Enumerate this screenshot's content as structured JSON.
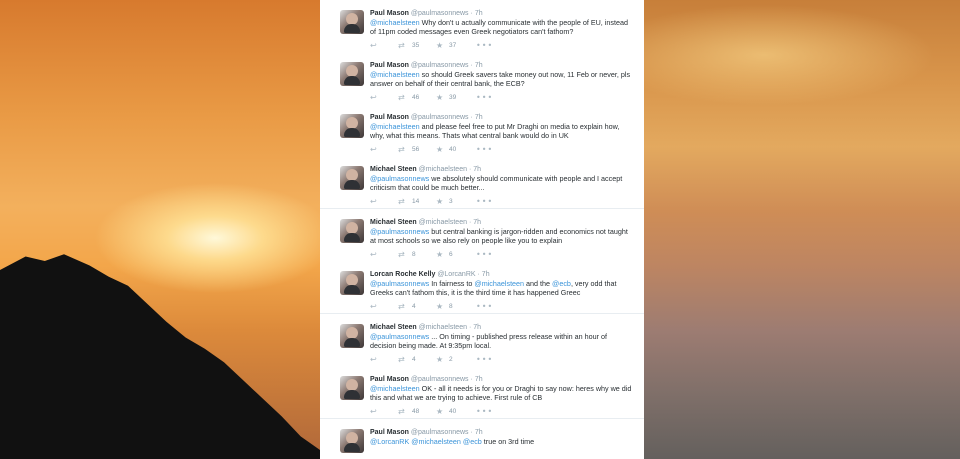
{
  "tweets": [
    {
      "name": "Paul Mason",
      "handle": "@paulmasonnews",
      "time": "7h",
      "mentions": [
        "@michaelsteen"
      ],
      "text": " Why don't u actually communicate with the people of EU, instead of 11pm coded messages even Greek negotiators can't fathom?",
      "retweets": "35",
      "favorites": "37"
    },
    {
      "name": "Paul Mason",
      "handle": "@paulmasonnews",
      "time": "7h",
      "mentions": [
        "@michaelsteen"
      ],
      "text": " so should Greek savers take money out now, 11 Feb or never, pls answer on behalf of their central bank, the ECB?",
      "retweets": "46",
      "favorites": "39"
    },
    {
      "name": "Paul Mason",
      "handle": "@paulmasonnews",
      "time": "7h",
      "mentions": [
        "@michaelsteen"
      ],
      "text": " and please feel free to put Mr Draghi on media to explain how, why, what this means. Thats what central bank would do in UK",
      "retweets": "56",
      "favorites": "40"
    },
    {
      "name": "Michael Steen",
      "handle": "@michaelsteen",
      "time": "7h",
      "mentions": [
        "@paulmasonnews"
      ],
      "text": " we absolutely should communicate with people and I accept criticism that could be much better...",
      "retweets": "14",
      "favorites": "3"
    },
    {
      "name": "Michael Steen",
      "handle": "@michaelsteen",
      "time": "7h",
      "mentions": [
        "@paulmasonnews"
      ],
      "text": " but central banking is jargon-ridden and economics not taught at most schools so we also rely on people like you to explain",
      "retweets": "8",
      "favorites": "6"
    },
    {
      "name": "Lorcan Roche Kelly",
      "handle": "@LorcanRK",
      "time": "7h",
      "mentions": [
        "@paulmasonnews",
        "@michaelsteen",
        "@ecb"
      ],
      "parts": [
        " In fairness to ",
        " and the ",
        ", very odd that Greeks can't fathom this, it is the third time it has happened Greec"
      ],
      "retweets": "4",
      "favorites": "8"
    },
    {
      "name": "Michael Steen",
      "handle": "@michaelsteen",
      "time": "7h",
      "mentions": [
        "@paulmasonnews"
      ],
      "text": " ... On timing - published press release within an hour of decision being made. At 9:35pm local.",
      "retweets": "4",
      "favorites": "2"
    },
    {
      "name": "Paul Mason",
      "handle": "@paulmasonnews",
      "time": "7h",
      "mentions": [
        "@michaelsteen"
      ],
      "text": " OK - all it needs is for you or Draghi to say now: heres why we did this and what we are trying to achieve. First rule of CB",
      "retweets": "48",
      "favorites": "40"
    },
    {
      "name": "Paul Mason",
      "handle": "@paulmasonnews",
      "time": "7h",
      "mentions": [
        "@LorcanRK",
        "@michaelsteen",
        "@ecb"
      ],
      "parts": [
        " ",
        " ",
        " true on 3rd time"
      ],
      "retweets": "",
      "favorites": "1"
    }
  ],
  "icons": {
    "reply": "reply-icon",
    "retweet": "retweet-icon",
    "favorite": "star-icon",
    "more": "more-icon"
  },
  "colors": {
    "mention": "#3b94d9",
    "name": "#292f33",
    "meta": "#8899a6",
    "icon": "#aab8c2"
  },
  "dot": "·"
}
